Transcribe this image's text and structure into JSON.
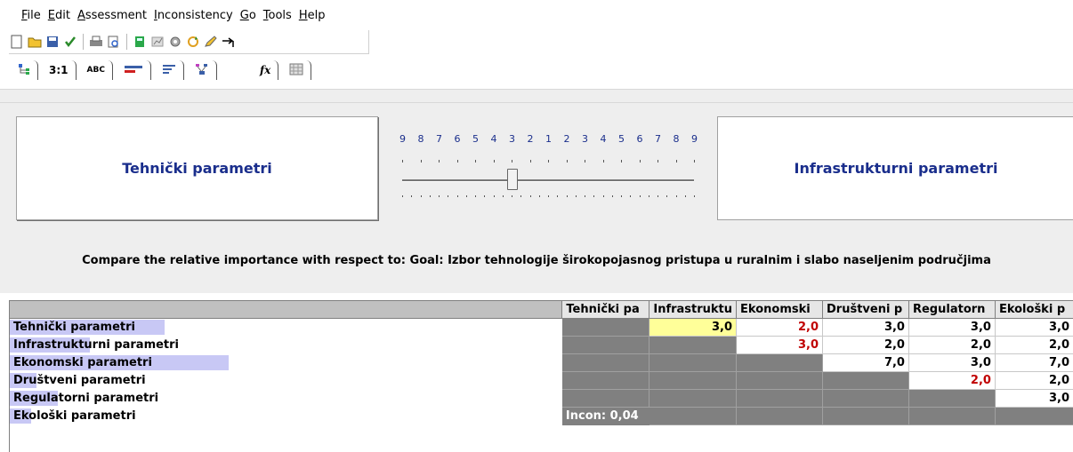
{
  "menu": [
    "File",
    "Edit",
    "Assessment",
    "Inconsistency",
    "Go",
    "Tools",
    "Help"
  ],
  "toolbar_icons": [
    "new-file-icon",
    "open-folder-icon",
    "save-icon",
    "check-icon",
    "print-icon",
    "print-preview-icon",
    "calculator-icon",
    "chart-icon",
    "gear-icon",
    "refresh-icon",
    "pencil-icon",
    "arrow-right-icon"
  ],
  "tabs": [
    {
      "name": "tree-view",
      "label": ""
    },
    {
      "name": "pairwise",
      "label": "3:1"
    },
    {
      "name": "verbal",
      "label": "ABC"
    },
    {
      "name": "graphical-bars",
      "label": ""
    },
    {
      "name": "bars",
      "label": ""
    },
    {
      "name": "structure",
      "label": ""
    },
    {
      "name": "formula",
      "label": "fx"
    },
    {
      "name": "matrix",
      "label": ""
    }
  ],
  "compare": {
    "left": "Tehnički parametri",
    "right": "Infrastrukturni parametri",
    "scale": [
      "9",
      "8",
      "7",
      "6",
      "5",
      "4",
      "3",
      "2",
      "1",
      "2",
      "3",
      "4",
      "5",
      "6",
      "7",
      "8",
      "9"
    ],
    "value": 3
  },
  "question": "Compare the relative importance with respect to: Goal: Izbor tehnologije širokopojasnog pristupa u ruralnim i slabo naseljenim područjima",
  "matrix": {
    "columns": [
      "Tehnički pa",
      "Infrastruktu",
      "Ekonomski",
      "Društveni p",
      "Regulatorn",
      "Ekološki p"
    ],
    "rows": [
      {
        "label": "Tehnički parametri",
        "highlight": 0.29,
        "cells": [
          null,
          "3,0",
          "2,0",
          "3,0",
          "3,0",
          "3,0"
        ],
        "red": [
          2
        ]
      },
      {
        "label": "Infrastrukturni parametri",
        "highlight": 0.15,
        "cells": [
          null,
          null,
          "3,0",
          "2,0",
          "2,0",
          "2,0"
        ],
        "red": [
          2
        ]
      },
      {
        "label": "Ekonomski parametri",
        "highlight": 0.41,
        "cells": [
          null,
          null,
          null,
          "7,0",
          "3,0",
          "7,0"
        ],
        "red": []
      },
      {
        "label": "Društveni parametri",
        "highlight": 0.05,
        "cells": [
          null,
          null,
          null,
          null,
          "2,0",
          "2,0"
        ],
        "red": [
          4
        ]
      },
      {
        "label": "Regulatorni parametri",
        "highlight": 0.09,
        "cells": [
          null,
          null,
          null,
          null,
          null,
          "3,0"
        ],
        "red": []
      },
      {
        "label": "Ekološki parametri",
        "highlight": 0.04,
        "cells": [
          "Incon: 0,04",
          null,
          null,
          null,
          null,
          null
        ],
        "red": []
      }
    ]
  }
}
